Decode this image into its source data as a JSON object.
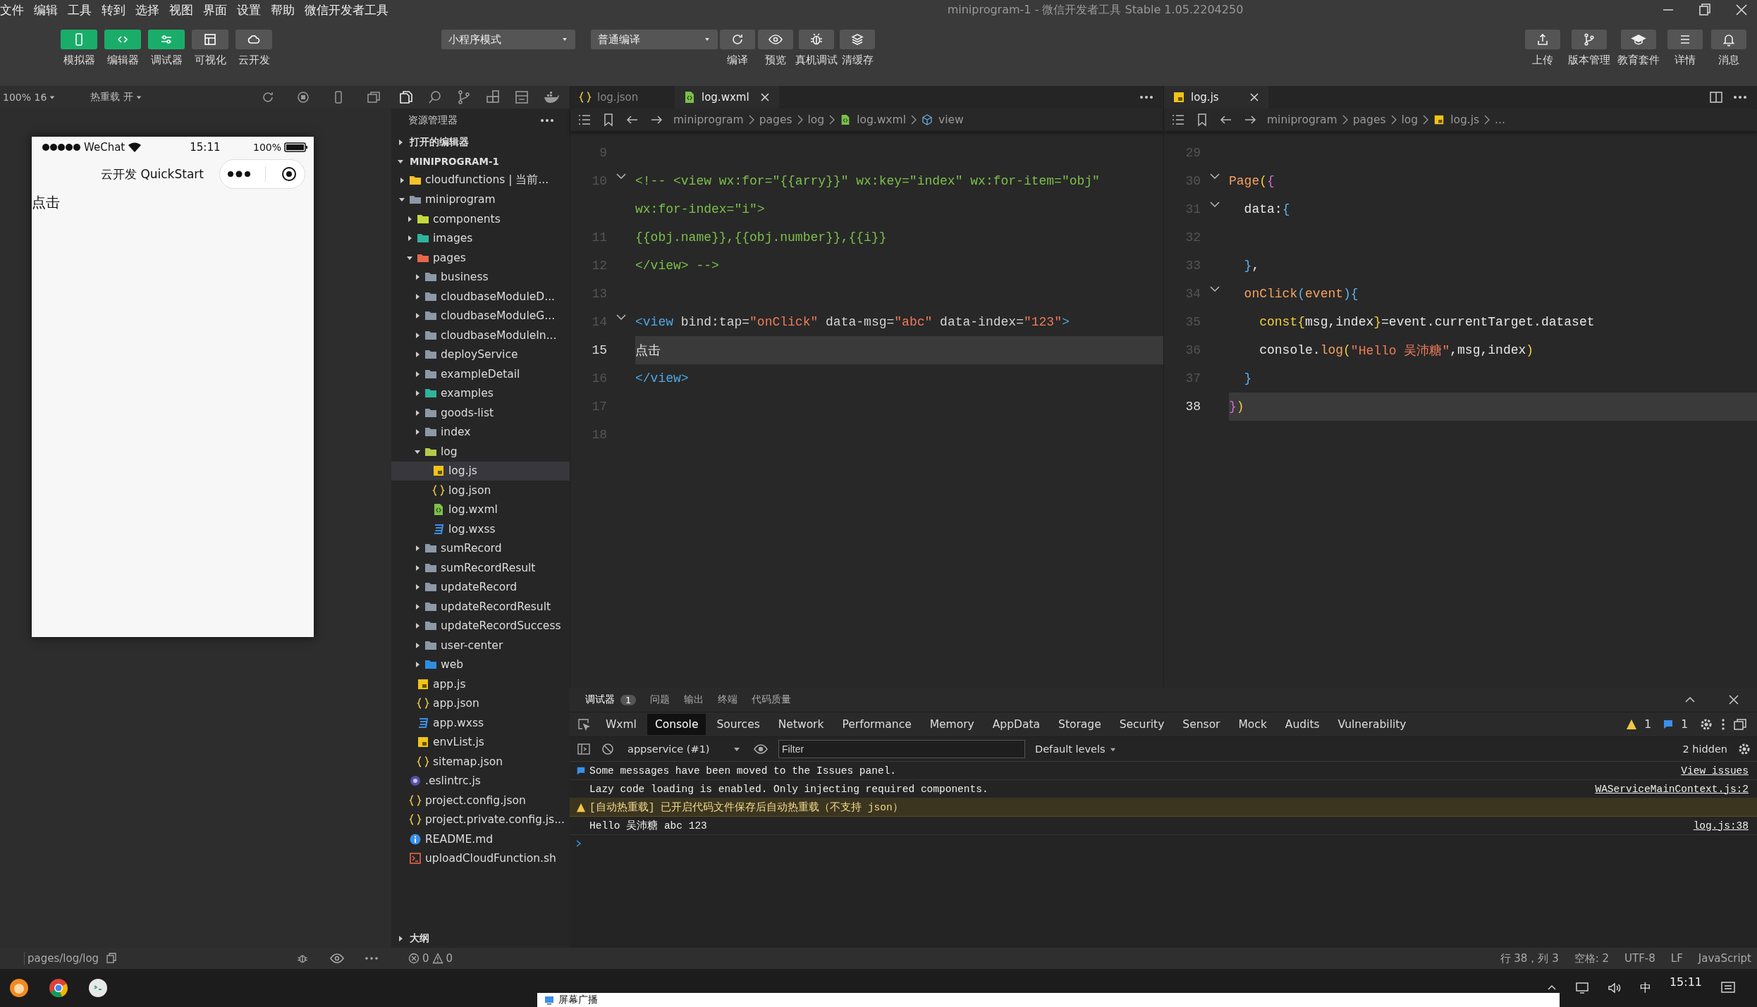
{
  "window": {
    "title": "miniprogram-1 - 微信开发者工具 Stable 1.05.2204250"
  },
  "menu": [
    "文件",
    "编辑",
    "工具",
    "转到",
    "选择",
    "视图",
    "界面",
    "设置",
    "帮助",
    "微信开发者工具"
  ],
  "toolbar": {
    "views": [
      {
        "label": "模拟器",
        "on": true
      },
      {
        "label": "编辑器",
        "on": true
      },
      {
        "label": "调试器",
        "on": true
      },
      {
        "label": "可视化",
        "on": false
      },
      {
        "label": "云开发",
        "on": false
      }
    ],
    "mode": "小程序模式",
    "compile_mode": "普通编译",
    "actions": [
      {
        "label": "编译"
      },
      {
        "label": "预览"
      },
      {
        "label": "真机调试"
      },
      {
        "label": "清缓存"
      }
    ],
    "right": [
      {
        "label": "上传"
      },
      {
        "label": "版本管理"
      },
      {
        "label": "教育套件"
      },
      {
        "label": "详情"
      },
      {
        "label": "消息"
      }
    ]
  },
  "simulator": {
    "zoom": "100% 16",
    "hot_reload": "热重载 开",
    "carrier": "WeChat",
    "time": "15:11",
    "battery": "100%",
    "nav_title": "云开发 QuickStart",
    "content": "点击",
    "path": "pages/log/log"
  },
  "explorer": {
    "title": "资源管理器",
    "open_editors": {
      "label": "打开的编辑器",
      "expanded": false
    },
    "project": {
      "label": "MINIPROGRAM-1",
      "expanded": true
    },
    "tree": [
      {
        "name": "cloudfunctions | 当前...",
        "kind": "cloud",
        "expanded": false,
        "selected": false
      },
      {
        "name": "miniprogram",
        "kind": "folder",
        "expanded": true,
        "selected": false,
        "children": [
          {
            "name": "components",
            "kind": "components",
            "expanded": false,
            "selected": false
          },
          {
            "name": "images",
            "kind": "images",
            "expanded": false,
            "selected": false
          },
          {
            "name": "pages",
            "kind": "pages",
            "expanded": true,
            "selected": false,
            "children": [
              {
                "name": "business",
                "kind": "folder",
                "expanded": false,
                "selected": false
              },
              {
                "name": "cloudbaseModuleD...",
                "kind": "folder",
                "expanded": false,
                "selected": false
              },
              {
                "name": "cloudbaseModuleG...",
                "kind": "folder",
                "expanded": false,
                "selected": false
              },
              {
                "name": "cloudbaseModuleIn...",
                "kind": "folder",
                "expanded": false,
                "selected": false
              },
              {
                "name": "deployService",
                "kind": "folder",
                "expanded": false,
                "selected": false
              },
              {
                "name": "exampleDetail",
                "kind": "folder",
                "expanded": false,
                "selected": false
              },
              {
                "name": "examples",
                "kind": "images",
                "expanded": false,
                "selected": false
              },
              {
                "name": "goods-list",
                "kind": "folder",
                "expanded": false,
                "selected": false
              },
              {
                "name": "index",
                "kind": "folder",
                "expanded": false,
                "selected": false
              },
              {
                "name": "log",
                "kind": "log",
                "expanded": true,
                "selected": false,
                "children": [
                  {
                    "name": "log.js",
                    "kind": "js",
                    "selected": true
                  },
                  {
                    "name": "log.json",
                    "kind": "json",
                    "selected": false
                  },
                  {
                    "name": "log.wxml",
                    "kind": "wxml",
                    "selected": false
                  },
                  {
                    "name": "log.wxss",
                    "kind": "wxss",
                    "selected": false
                  }
                ]
              },
              {
                "name": "sumRecord",
                "kind": "folder",
                "expanded": false,
                "selected": false
              },
              {
                "name": "sumRecordResult",
                "kind": "folder",
                "expanded": false,
                "selected": false
              },
              {
                "name": "updateRecord",
                "kind": "folder",
                "expanded": false,
                "selected": false
              },
              {
                "name": "updateRecordResult",
                "kind": "folder",
                "expanded": false,
                "selected": false
              },
              {
                "name": "updateRecordSuccess",
                "kind": "folder",
                "expanded": false,
                "selected": false
              },
              {
                "name": "user-center",
                "kind": "folder",
                "expanded": false,
                "selected": false
              },
              {
                "name": "web",
                "kind": "web",
                "expanded": false,
                "selected": false
              }
            ]
          },
          {
            "name": "app.js",
            "kind": "js",
            "selected": false
          },
          {
            "name": "app.json",
            "kind": "json",
            "selected": false
          },
          {
            "name": "app.wxss",
            "kind": "wxss",
            "selected": false
          },
          {
            "name": "envList.js",
            "kind": "js",
            "selected": false
          },
          {
            "name": "sitemap.json",
            "kind": "json",
            "selected": false
          }
        ]
      },
      {
        "name": ".eslintrc.js",
        "kind": "eslint",
        "selected": false
      },
      {
        "name": "project.config.json",
        "kind": "json",
        "selected": false
      },
      {
        "name": "project.private.config.js...",
        "kind": "json",
        "selected": false
      },
      {
        "name": "README.md",
        "kind": "info",
        "selected": false
      },
      {
        "name": "uploadCloudFunction.sh",
        "kind": "shell",
        "selected": false
      }
    ],
    "outline": {
      "label": "大纲",
      "expanded": false
    },
    "errors": "0",
    "warnings": "0"
  },
  "editors": [
    {
      "tabs": [
        {
          "label": "log.json",
          "kind": "json",
          "selected": false
        },
        {
          "label": "log.wxml",
          "kind": "wxml",
          "selected": true
        }
      ],
      "breadcrumb": [
        {
          "label": "miniprogram",
          "kind": "folder"
        },
        {
          "label": "pages",
          "kind": "folder"
        },
        {
          "label": "log",
          "kind": "folder"
        },
        {
          "label": "log.wxml",
          "kind": "wxml"
        },
        {
          "label": "view",
          "kind": "element"
        }
      ],
      "lines": [
        {
          "n": "9",
          "fold": false,
          "current": false
        },
        {
          "n": "10",
          "fold": true,
          "current": false,
          "t": [
            {
              "s": "<!-- <view wx:for=\"{{arry}}\" wx:key=\"index\" wx:for-item=\"obj\"",
              "kind": "comment"
            }
          ]
        },
        {
          "fold": false,
          "current": false,
          "t": [
            {
              "s": "wx:for-index=\"i\">",
              "kind": "comment"
            }
          ]
        },
        {
          "n": "11",
          "fold": false,
          "current": false,
          "t": [
            {
              "s": "{{obj.name}},{{obj.number}},{{i}}",
              "kind": "comment"
            }
          ]
        },
        {
          "n": "12",
          "fold": false,
          "current": false,
          "t": [
            {
              "s": "</view> -->",
              "kind": "comment"
            }
          ]
        },
        {
          "n": "13",
          "fold": false,
          "current": false
        },
        {
          "n": "14",
          "fold": true,
          "current": false,
          "t": [
            {
              "s": "<view",
              "kind": "tag"
            },
            {
              "s": " bind:tap=",
              "kind": "attr"
            },
            {
              "s": "\"onClick\"",
              "kind": "str"
            },
            {
              "s": " data-msg=",
              "kind": "attr"
            },
            {
              "s": "\"abc\"",
              "kind": "str"
            },
            {
              "s": " data-index=",
              "kind": "attr"
            },
            {
              "s": "\"123\"",
              "kind": "str"
            },
            {
              "s": ">",
              "kind": "tag"
            }
          ]
        },
        {
          "n": "15",
          "fold": false,
          "current": true,
          "t": [
            {
              "s": "点击",
              "kind": "text"
            }
          ]
        },
        {
          "n": "16",
          "fold": false,
          "current": false,
          "t": [
            {
              "s": "</view>",
              "kind": "tag"
            }
          ]
        },
        {
          "n": "17",
          "fold": false,
          "current": false
        },
        {
          "n": "18",
          "fold": false,
          "current": false
        }
      ]
    },
    {
      "tabs": [
        {
          "label": "log.js",
          "kind": "js",
          "selected": true
        }
      ],
      "breadcrumb": [
        {
          "label": "miniprogram",
          "kind": "folder"
        },
        {
          "label": "pages",
          "kind": "folder"
        },
        {
          "label": "log",
          "kind": "folder"
        },
        {
          "label": "log.js",
          "kind": "js"
        },
        {
          "label": "...",
          "kind": "folder"
        }
      ],
      "lines": [
        {
          "n": "29",
          "fold": false,
          "current": false
        },
        {
          "n": "30",
          "fold": true,
          "current": false,
          "t": [
            {
              "s": "Page",
              "kind": "fn"
            },
            {
              "s": "(",
              "kind": "kw"
            },
            {
              "s": "{",
              "kind": "brace"
            }
          ]
        },
        {
          "n": "31",
          "fold": true,
          "current": false,
          "t": [
            {
              "s": "  data:",
              "kind": "text"
            },
            {
              "s": "{",
              "kind": "blue"
            }
          ]
        },
        {
          "n": "32",
          "fold": false,
          "current": false
        },
        {
          "n": "33",
          "fold": false,
          "current": false,
          "t": [
            {
              "s": "  }",
              "kind": "blue"
            },
            {
              "s": ",",
              "kind": "text"
            }
          ]
        },
        {
          "n": "34",
          "fold": true,
          "current": false,
          "t": [
            {
              "s": "  onClick",
              "kind": "fn"
            },
            {
              "s": "(",
              "kind": "blue"
            },
            {
              "s": "event",
              "kind": "fn"
            },
            {
              "s": "){",
              "kind": "blue"
            }
          ]
        },
        {
          "n": "35",
          "fold": false,
          "current": false,
          "t": [
            {
              "s": "    const",
              "kind": "kw"
            },
            {
              "s": "{",
              "kind": "kw"
            },
            {
              "s": "msg,index",
              "kind": "text"
            },
            {
              "s": "}",
              "kind": "kw"
            },
            {
              "s": "=event.currentTarget.dataset",
              "kind": "text"
            }
          ]
        },
        {
          "n": "36",
          "fold": false,
          "current": false,
          "t": [
            {
              "s": "    console.",
              "kind": "text"
            },
            {
              "s": "log",
              "kind": "fn"
            },
            {
              "s": "(",
              "kind": "kw"
            },
            {
              "s": "\"Hello 吴沛糖\"",
              "kind": "str"
            },
            {
              "s": ",msg,index",
              "kind": "text"
            },
            {
              "s": ")",
              "kind": "kw"
            }
          ]
        },
        {
          "n": "37",
          "fold": false,
          "current": false,
          "t": [
            {
              "s": "  }",
              "kind": "blue"
            }
          ]
        },
        {
          "n": "38",
          "fold": false,
          "current": true,
          "t": [
            {
              "s": "}",
              "kind": "brace"
            },
            {
              "s": ")",
              "kind": "kw"
            }
          ]
        }
      ]
    }
  ],
  "console": {
    "panel_tabs": [
      {
        "label": "调试器",
        "selected": true,
        "badge": "1"
      },
      {
        "label": "问题",
        "selected": false
      },
      {
        "label": "输出",
        "selected": false
      },
      {
        "label": "终端",
        "selected": false
      },
      {
        "label": "代码质量",
        "selected": false
      }
    ],
    "tabs": [
      {
        "label": "Wxml",
        "selected": false
      },
      {
        "label": "Console",
        "selected": true
      },
      {
        "label": "Sources",
        "selected": false
      },
      {
        "label": "Network",
        "selected": false
      },
      {
        "label": "Performance",
        "selected": false
      },
      {
        "label": "Memory",
        "selected": false
      },
      {
        "label": "AppData",
        "selected": false
      },
      {
        "label": "Storage",
        "selected": false
      },
      {
        "label": "Security",
        "selected": false
      },
      {
        "label": "Sensor",
        "selected": false
      },
      {
        "label": "Mock",
        "selected": false
      },
      {
        "label": "Audits",
        "selected": false
      },
      {
        "label": "Vulnerability",
        "selected": false
      }
    ],
    "warning_count": "1",
    "info_count": "1",
    "context": "appservice (#1)",
    "filter_placeholder": "Filter",
    "levels": "Default levels",
    "hidden": "2 hidden",
    "messages": [
      {
        "kind": "info",
        "text": "Some messages have been moved to the Issues panel.",
        "source": "View issues"
      },
      {
        "kind": "log",
        "text": "Lazy code loading is enabled. Only injecting required components.",
        "source": "WAServiceMainContext.js:2"
      },
      {
        "kind": "warning",
        "text": "[自动热重载] 已开启代码文件保存后自动热重载（不支持 json）"
      },
      {
        "kind": "log",
        "text": "Hello 吴沛糖 abc 123",
        "source": "log.js:38"
      }
    ]
  },
  "status_bar": [
    "行 38，列 3",
    "空格: 2",
    "UTF-8",
    "LF",
    "JavaScript"
  ],
  "taskbar": {
    "notification": "屏幕广播",
    "ime": "中",
    "time": "15:11"
  }
}
